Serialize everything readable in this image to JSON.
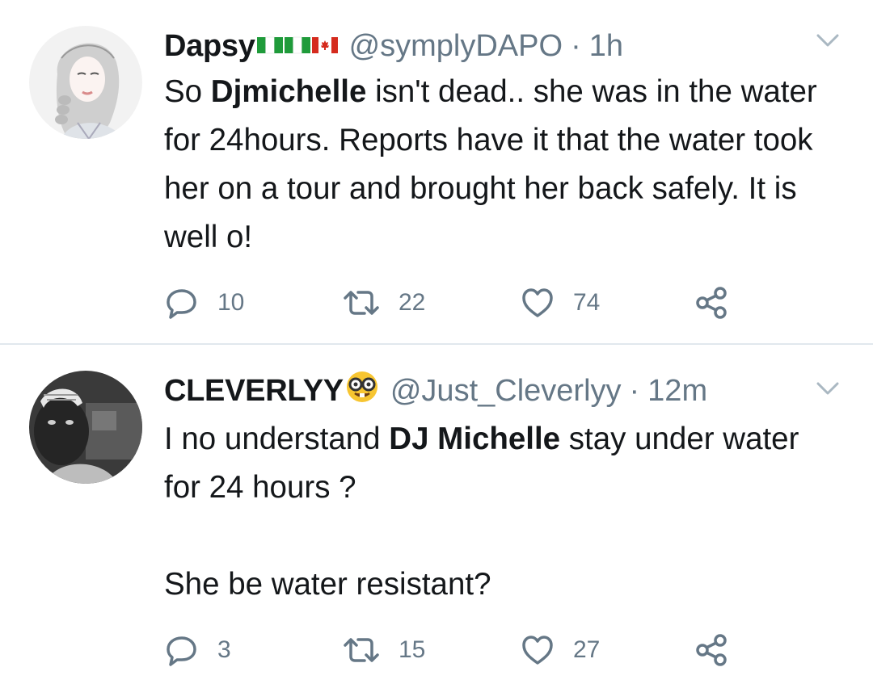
{
  "tweets": [
    {
      "display_name": "Dapsy",
      "handle": "@symplyDAPO",
      "separator": "·",
      "time": "1h",
      "body": {
        "p1_before": "So ",
        "p1_bold": "Djmichelle",
        "p1_after": " isn't dead.. she was in the water for 24hours. Reports have it that the water took her on a tour and brought her back safely. It is well o!"
      },
      "replies": "10",
      "retweets": "22",
      "likes": "74"
    },
    {
      "display_name": "CLEVERLYY",
      "handle": "@Just_Cleverlyy",
      "separator": "·",
      "time": "12m",
      "body": {
        "p1_before": "I no understand ",
        "p1_bold": "DJ Michelle",
        "p1_after": " stay under water for 24 hours ?",
        "p2": "She be water resistant?"
      },
      "replies": "3",
      "retweets": "15",
      "likes": "27"
    }
  ],
  "icons": {
    "reply": "reply-icon",
    "retweet": "retweet-icon",
    "like": "heart-icon",
    "share": "share-icon",
    "more": "chevron-down-icon"
  },
  "colors": {
    "text": "#14171a",
    "secondary": "#657786",
    "divider": "#e1e8ed",
    "chevron": "#aab8c2"
  }
}
